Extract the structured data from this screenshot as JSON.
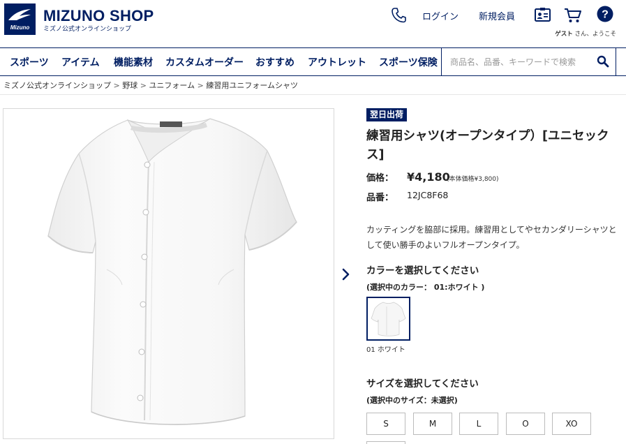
{
  "header": {
    "logo_text": "Mizuno",
    "shop_title": "MIZUNO SHOP",
    "shop_subtitle": "ミズノ公式オンラインショップ",
    "login_label": "ログイン",
    "register_label": "新規会員",
    "guest_name": "ゲスト",
    "guest_suffix": "さん、ようこそ",
    "icons": [
      "phone-icon",
      "member-card-icon",
      "cart-icon",
      "help-icon"
    ]
  },
  "nav": {
    "items": [
      "スポーツ",
      "アイテム",
      "機能素材",
      "カスタムオーダー",
      "おすすめ",
      "アウトレット",
      "スポーツ保険"
    ],
    "search_placeholder": "商品名、品番、キーワードで検索"
  },
  "breadcrumb": [
    "ミズノ公式オンラインショップ",
    "野球",
    "ユニフォーム",
    "練習用ユニフォームシャツ"
  ],
  "product": {
    "badge": "翌日出荷",
    "title": "練習用シャツ(オープンタイプ）[ユニセックス]",
    "price_label": "価格：",
    "price": "¥4,180",
    "price_note": "(本体価格¥3,800)",
    "code_label": "品番：",
    "code": "12JC8F68",
    "description": "カッティングを脇部に採用。練習用としてやセカンダリーシャツとして使い勝手のよいフルオープンタイプ。",
    "color_heading": "カラーを選択してください",
    "color_selected": "(選択中のカラー： 01:ホワイト )",
    "swatch_label": "01 ホワイト",
    "size_heading": "サイズを選択してください",
    "size_selected": "(選択中のサイズ：未選択)",
    "sizes": [
      "S",
      "M",
      "L",
      "O",
      "XO"
    ]
  },
  "colors": {
    "brand": "#001e62",
    "border": "#d8d8d8"
  }
}
